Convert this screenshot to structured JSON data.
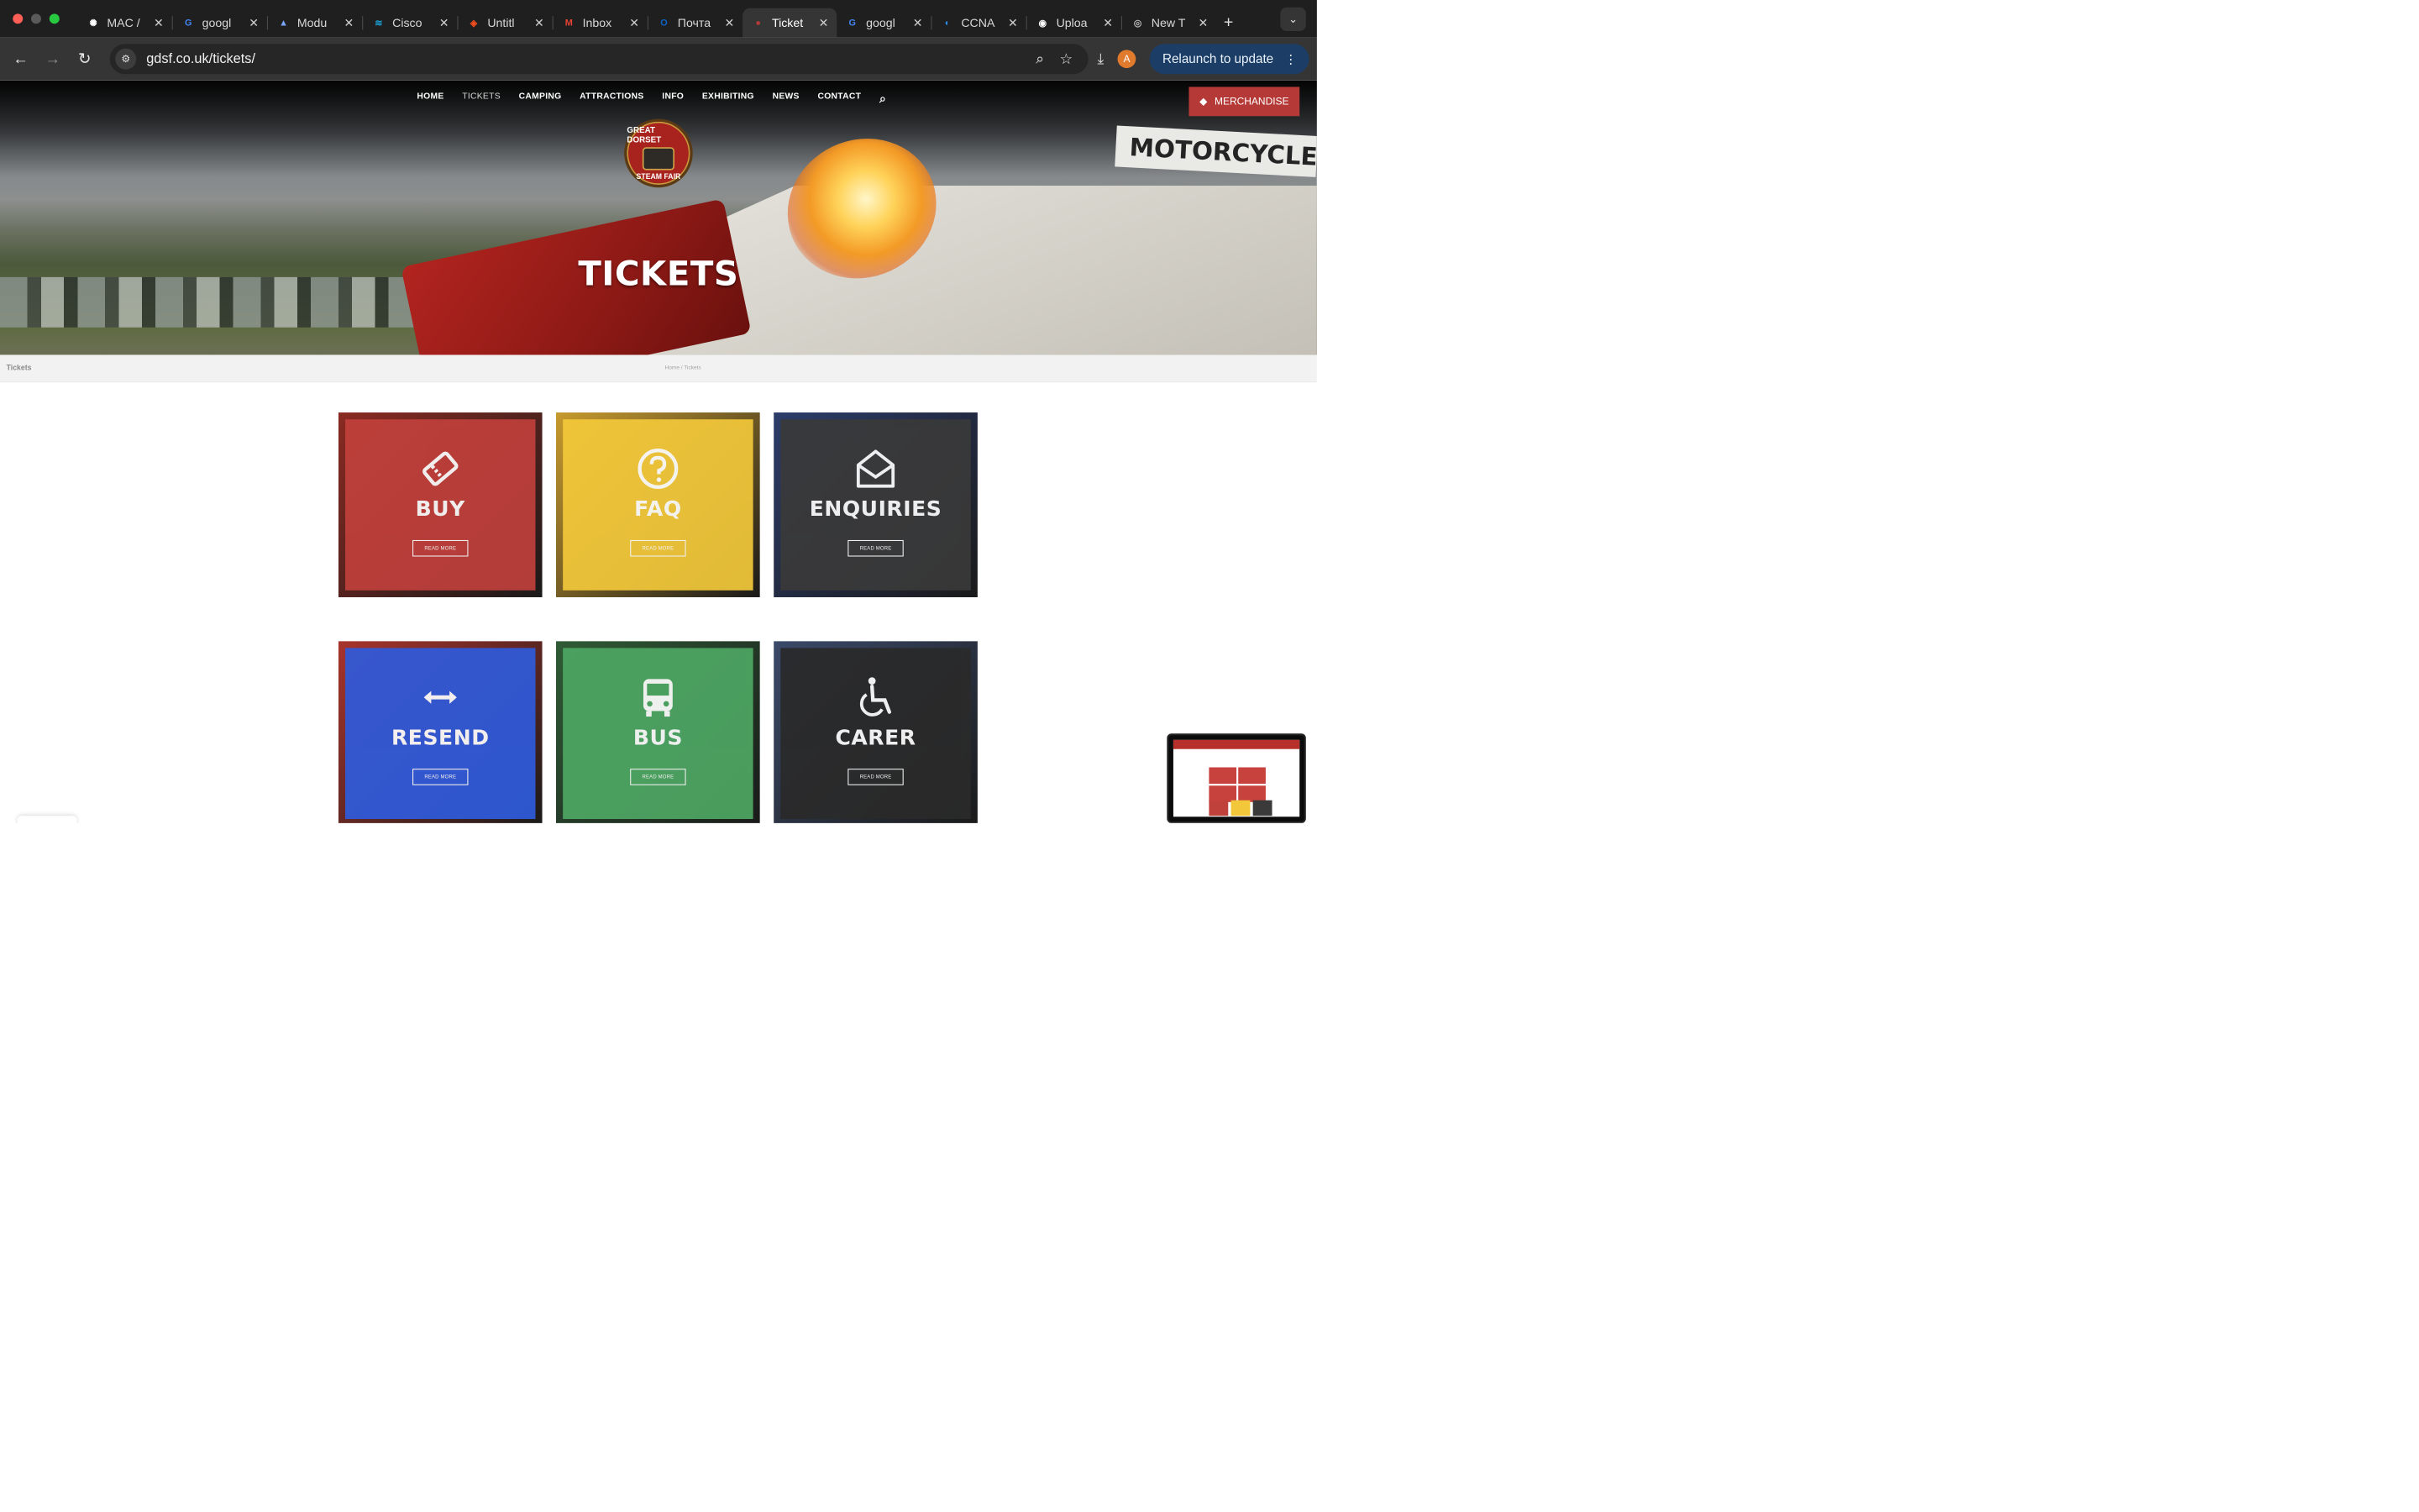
{
  "browser": {
    "tabs": [
      {
        "label": "MAC /",
        "icon": "openai-icon",
        "color": "#ffffff"
      },
      {
        "label": "googl",
        "icon": "google-icon",
        "color": "#4285f4"
      },
      {
        "label": "Modu",
        "icon": "delta-icon",
        "color": "#7aa7ff"
      },
      {
        "label": "Cisco",
        "icon": "cisco-icon",
        "color": "#1ba0d7"
      },
      {
        "label": "Untitl",
        "icon": "figma-icon",
        "color": "#f24e1e"
      },
      {
        "label": "Inbox",
        "icon": "gmail-icon",
        "color": "#ea4335"
      },
      {
        "label": "Почта",
        "icon": "outlook-icon",
        "color": "#0a64c8"
      },
      {
        "label": "Ticket",
        "icon": "gdsf-favicon",
        "color": "#b53a37",
        "active": true
      },
      {
        "label": "googl",
        "icon": "google-icon",
        "color": "#4285f4"
      },
      {
        "label": "CCNA",
        "icon": "netacad-icon",
        "color": "#2b8ce6"
      },
      {
        "label": "Uploa",
        "icon": "github-icon",
        "color": "#ffffff"
      },
      {
        "label": "New T",
        "icon": "chrome-icon",
        "color": "#bdbdbd"
      }
    ],
    "url": "gdsf.co.uk/tickets/",
    "avatar_letter": "A",
    "relaunch_label": "Relaunch to update"
  },
  "site": {
    "nav": [
      "HOME",
      "TICKETS",
      "CAMPING",
      "ATTRACTIONS",
      "INFO",
      "EXHIBITING",
      "NEWS",
      "CONTACT"
    ],
    "nav_current": "TICKETS",
    "merch_label": "MERCHANDISE",
    "logo": {
      "top": "GREAT DORSET",
      "bottom": "STEAM FAIR"
    },
    "hero_title": "TICKETS",
    "hero_banner": "MOTORCYCLE",
    "page_title": "Tickets",
    "breadcrumb": "Home / Tickets"
  },
  "cards": [
    {
      "title": "BUY",
      "button": "READ MORE",
      "icon": "ticket-icon",
      "overlay": "#c0403c",
      "photo": "#8a2a22"
    },
    {
      "title": "FAQ",
      "button": "READ MORE",
      "icon": "question-circle-icon",
      "overlay": "#f2c83a",
      "photo": "#c79a2e"
    },
    {
      "title": "ENQUIRIES",
      "button": "READ MORE",
      "icon": "envelope-open-icon",
      "overlay": "#3a3a3a",
      "photo": "#2c3c6a"
    },
    {
      "title": "RESEND",
      "button": "READ MORE",
      "icon": "arrows-horizontal-icon",
      "overlay": "#2f5bdc",
      "photo": "#a8342c"
    },
    {
      "title": "BUS",
      "button": "READ MORE",
      "icon": "bus-icon",
      "overlay": "#4ea763",
      "photo": "#2f5b35"
    },
    {
      "title": "CARER",
      "button": "READ MORE",
      "icon": "wheelchair-icon",
      "overlay": "#2a2a2a",
      "photo": "#3b4a6a"
    }
  ]
}
